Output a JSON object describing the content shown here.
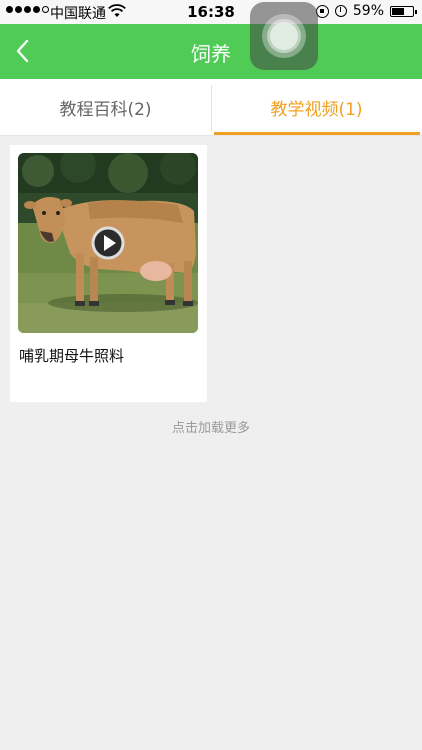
{
  "status_bar": {
    "carrier": "中国联通",
    "time": "16:38",
    "battery": "59%",
    "battery_level": 0.59,
    "icons": [
      "signal-icon",
      "wifi-icon",
      "rotation-lock-icon",
      "alarm-icon",
      "battery-icon"
    ]
  },
  "nav": {
    "title": "饲养",
    "back_icon": "chevron-left-icon",
    "color": "#4fcb56"
  },
  "tabs": [
    {
      "label": "教程百科(2)",
      "active": false
    },
    {
      "label": "教学视频(1)",
      "active": true
    }
  ],
  "accent_color": "#f0a020",
  "videos": [
    {
      "title": "哺乳期母牛照料",
      "thumbnail": "cow-photo",
      "icon": "play-icon"
    }
  ],
  "load_more": "点击加载更多"
}
